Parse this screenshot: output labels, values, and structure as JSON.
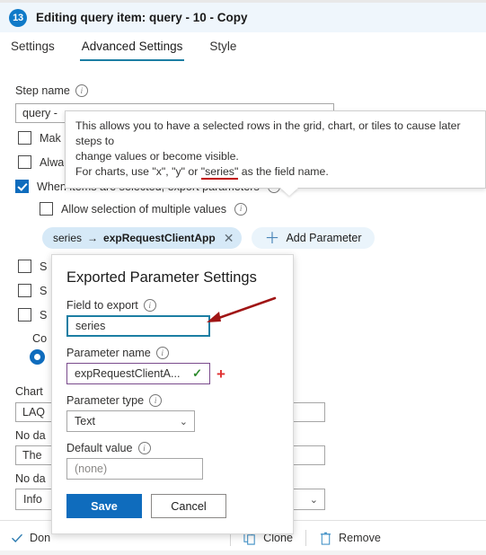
{
  "header": {
    "badge": "13",
    "title": "Editing query item: query - 10 - Copy"
  },
  "tabs": [
    {
      "label": "Settings",
      "active": false
    },
    {
      "label": "Advanced Settings",
      "active": true
    },
    {
      "label": "Style",
      "active": false
    }
  ],
  "form": {
    "step_name_label": "Step name",
    "step_name_value": "query -",
    "checkbox_make_label": "Mak",
    "checkbox_always_label": "Alwa",
    "export_params_label": "When items are selected, export parameters",
    "allow_multiple_label": "Allow selection of multiple values",
    "pill_field": "series",
    "pill_arrow": "→",
    "pill_param": "expRequestClientApp",
    "pill_close": "✕",
    "add_parameter_label": "Add Parameter",
    "hidden_checkbox_1": "S",
    "hidden_checkbox_2": "S",
    "hidden_checkbox_3": "S",
    "hidden_radio_label": "Co",
    "chart_label": "Chart",
    "chart_value": "LAQ",
    "no_data_label_1": "No da",
    "no_data_value_1": "The",
    "no_data_label_2": "No da",
    "no_data_value_2": "Info"
  },
  "tooltip": {
    "line1": "This allows you to have a selected rows in the grid, chart, or tiles to cause later steps to",
    "line2": "change values or become visible.",
    "line3_pre": "For charts, use \"x\", \"y\" or ",
    "line3_highlight": "\"series\"",
    "line3_post": " as the field name."
  },
  "dialog": {
    "title": "Exported Parameter Settings",
    "field_to_export_label": "Field to export",
    "field_to_export_value": "series",
    "parameter_name_label": "Parameter name",
    "parameter_name_value": "expRequestClientA...",
    "parameter_name_check": "✓",
    "parameter_name_add": "+",
    "parameter_type_label": "Parameter type",
    "parameter_type_value": "Text",
    "parameter_type_chevron": "⌄",
    "default_value_label": "Default value",
    "default_value_placeholder": "(none)",
    "save_label": "Save",
    "cancel_label": "Cancel"
  },
  "toolbar": {
    "done_label": "Don",
    "clone_label": "Clone",
    "remove_label": "Remove"
  },
  "colors": {
    "accent_blue": "#0f6cbd",
    "tab_underline": "#1c7ea3",
    "header_bg": "#eff6fc",
    "pill_bg": "#d6e9f7",
    "annotation_red": "#c00000"
  }
}
